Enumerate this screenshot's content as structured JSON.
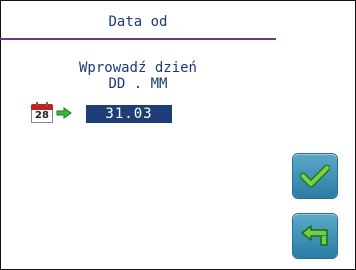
{
  "header": {
    "title": "Data od"
  },
  "prompt": {
    "line1": "Wprowadź dzień",
    "line2": "DD . MM"
  },
  "calendar_icon": {
    "day": "28"
  },
  "date_input": {
    "value": "31.03"
  },
  "buttons": {
    "ok_icon": "checkmark-icon",
    "back_icon": "back-arrow-icon"
  },
  "colors": {
    "accent_line": "#7a2d8c",
    "text": "#1a3a78",
    "input_bg": "#1f3e78",
    "button": "#3b8fb6"
  }
}
